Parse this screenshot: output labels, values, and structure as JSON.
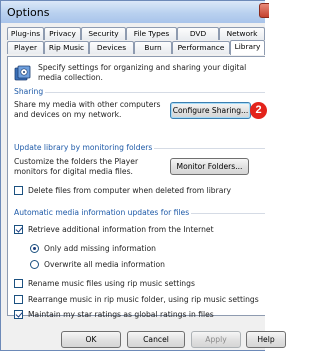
{
  "window": {
    "title": "Options"
  },
  "tabs": {
    "row1": [
      {
        "label": "Plug-ins"
      },
      {
        "label": "Privacy"
      },
      {
        "label": "Security"
      },
      {
        "label": "File Types"
      },
      {
        "label": "DVD"
      },
      {
        "label": "Network"
      }
    ],
    "row2": [
      {
        "label": "Player"
      },
      {
        "label": "Rip Music"
      },
      {
        "label": "Devices"
      },
      {
        "label": "Burn"
      },
      {
        "label": "Performance"
      },
      {
        "label": "Library"
      }
    ],
    "active": "Library"
  },
  "header": {
    "icon": "media-library-icon",
    "text": "Specify settings for organizing and sharing your digital media collection."
  },
  "sharing": {
    "title": "Sharing",
    "text": "Share my media with other computers and devices on my network.",
    "button": "Configure Sharing...",
    "callout": "2"
  },
  "monitoring": {
    "title": "Update library by monitoring folders",
    "text": "Customize the folders the Player monitors for digital media files.",
    "button": "Monitor Folders...",
    "delete_files": {
      "label": "Delete files from computer when deleted from library",
      "checked": false
    }
  },
  "automatic": {
    "title": "Automatic media information updates for files",
    "retrieve": {
      "label": "Retrieve additional information from the Internet",
      "checked": true
    },
    "only_add": {
      "label": "Only add missing information",
      "selected": true
    },
    "overwrite": {
      "label": "Overwrite all media information",
      "selected": false
    },
    "rename": {
      "label": "Rename music files using rip music settings",
      "checked": false
    },
    "rearrange": {
      "label": "Rearrange music in rip music folder, using rip music settings",
      "checked": false
    },
    "maintain": {
      "label": "Maintain my star ratings as global ratings in files",
      "checked": true
    }
  },
  "footer": {
    "ok": "OK",
    "cancel": "Cancel",
    "apply": "Apply",
    "help": "Help"
  }
}
